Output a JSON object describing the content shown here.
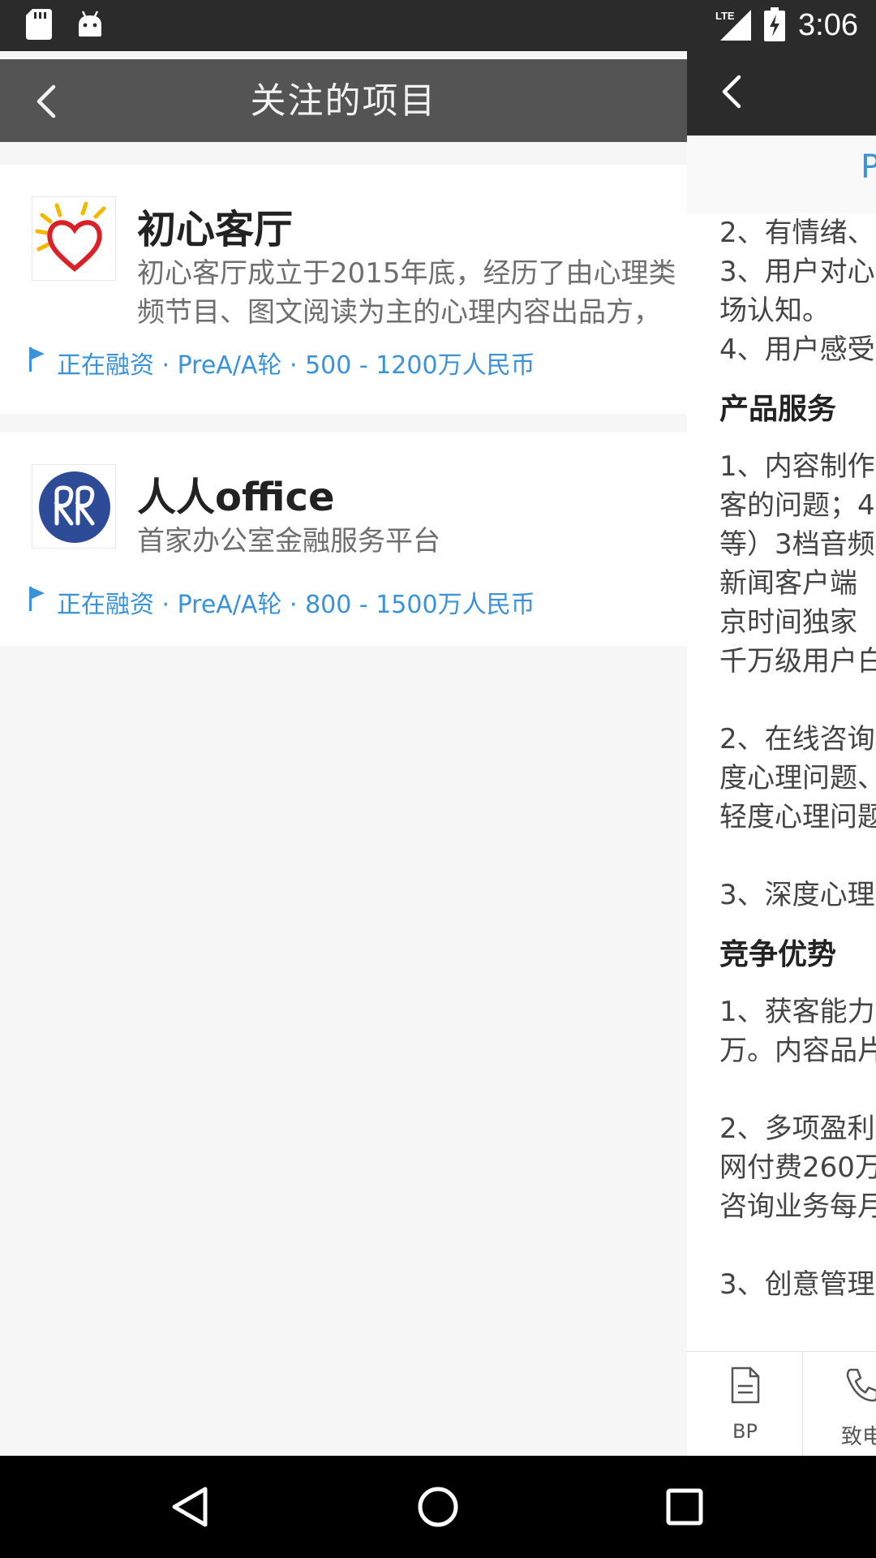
{
  "status_bar": {
    "time": "3:06",
    "network": "LTE",
    "icons": [
      "sd-card-icon",
      "android-icon",
      "lte-signal-icon",
      "battery-charging-icon"
    ]
  },
  "left_page": {
    "title": "关注的项目",
    "projects": [
      {
        "name": "初心客厅",
        "desc_line1": "初心客厅成立于2015年底，经历了由心理类",
        "desc_line2": "频节目、图文阅读为主的心理内容出品方，",
        "funding": "正在融资 · PreA/A轮 · 500 - 1200万人民币"
      },
      {
        "name": "人人office",
        "desc_line1": "首家办公室金融服务平台",
        "desc_line2": "",
        "funding": "正在融资 · PreA/A轮 · 800 - 1500万人民币"
      }
    ]
  },
  "right_page": {
    "tab_label": "P",
    "lines": [
      "2、有情绪、",
      "3、用户对心",
      "场认知。",
      "4、用户感受"
    ],
    "heading_product": "产品服务",
    "product_lines": [
      "1、内容制作",
      "客的问题；4",
      "等）3档音频",
      "新闻客户端",
      "京时间独家",
      "千万级用户白"
    ],
    "consult_lines": [
      "2、在线咨询",
      "度心理问题、",
      "轻度心理问题"
    ],
    "deep_line": "3、深度心理",
    "heading_advantage": "竞争优势",
    "adv_lines": [
      "1、获客能力",
      "万。内容品片"
    ],
    "profit_lines": [
      "2、多项盈利",
      "网付费260万",
      "咨询业务每月"
    ],
    "cut_line": "3、创意管理",
    "bottom": {
      "bp_label": "BP",
      "call_label": "致电"
    }
  },
  "colors": {
    "accent": "#3a92d8",
    "status_bar": "#2b2b2b",
    "left_topbar": "#545454"
  }
}
